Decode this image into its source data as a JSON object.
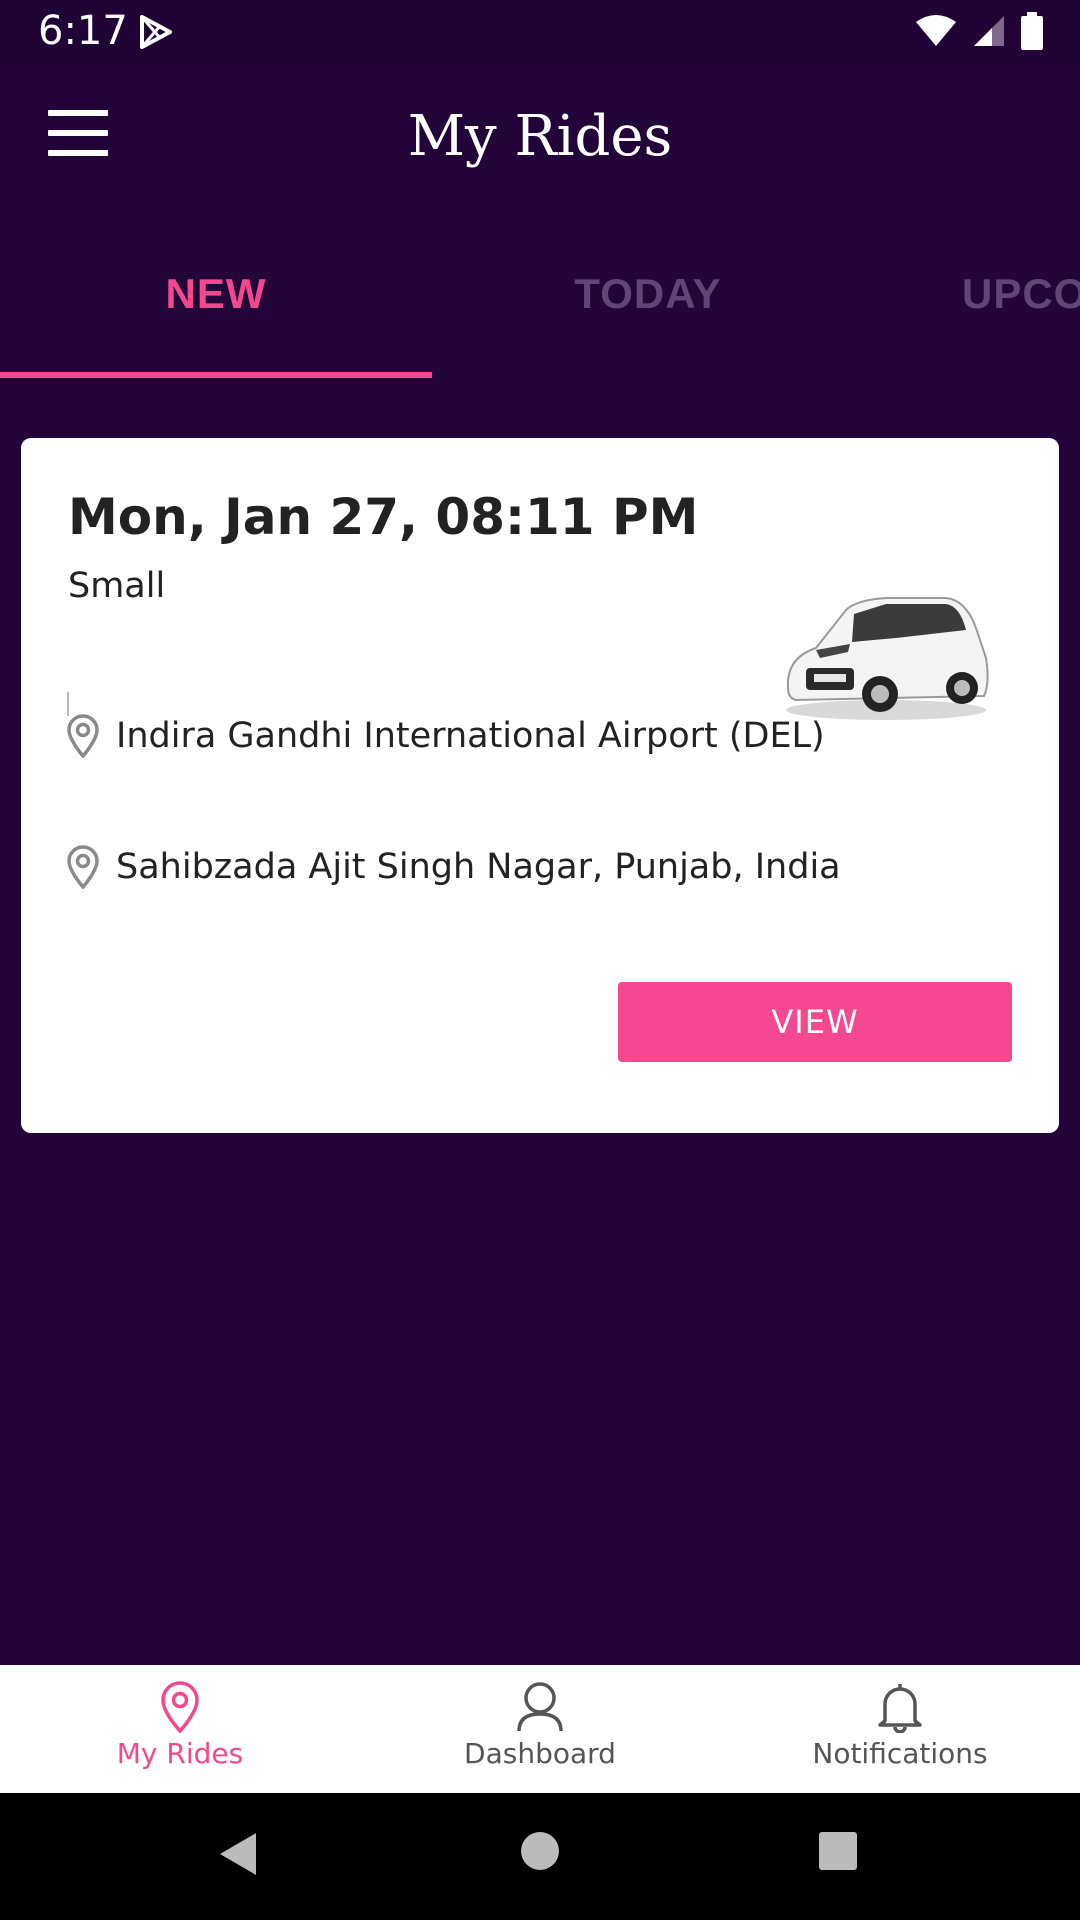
{
  "status_bar": {
    "time": "6:17",
    "icons": [
      "play-store-icon",
      "wifi-icon",
      "signal-icon",
      "battery-icon"
    ]
  },
  "app_bar": {
    "title": "My Rides",
    "menu_icon": "hamburger-menu-icon"
  },
  "tabs": {
    "items": [
      {
        "label": "NEW",
        "active": true
      },
      {
        "label": "TODAY",
        "active": false
      },
      {
        "label": "UPCOMING",
        "active": false
      }
    ]
  },
  "ride": {
    "datetime": "Mon, Jan 27, 08:11 PM",
    "car_type": "Small",
    "pickup": "Indira Gandhi International Airport (DEL)",
    "dropoff": "Sahibzada Ajit Singh Nagar, Punjab, India",
    "view_label": "VIEW"
  },
  "bottom_nav": {
    "items": [
      {
        "label": "My Rides",
        "icon": "location-pin-icon",
        "active": true
      },
      {
        "label": "Dashboard",
        "icon": "person-icon",
        "active": false
      },
      {
        "label": "Notifications",
        "icon": "bell-icon",
        "active": false
      }
    ]
  },
  "colors": {
    "background": "#22043b",
    "accent": "#f2498e",
    "inactive_tab": "#5f4676"
  }
}
